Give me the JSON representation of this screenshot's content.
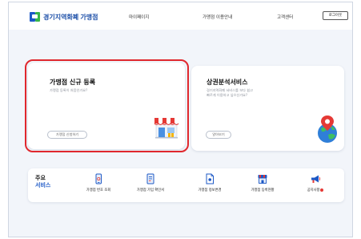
{
  "header": {
    "logo_text": "경기지역화폐 가맹점",
    "nav": [
      "마이페이지",
      "가맹점 이용안내",
      "고객센터"
    ],
    "logout_label": "로그아웃"
  },
  "cards": {
    "registration": {
      "title": "가맹점 신규 등록",
      "desc": "가맹점 등록이 처음인가요?",
      "button": "가맹점 신청하기",
      "icon": "store-icon"
    },
    "analysis": {
      "title": "상권분석서비스",
      "desc_line1": "경기지역화폐 서비스를 보다 쉽고",
      "desc_line2": "빠르게 이용하고 싶으신가요?",
      "button": "알아보기",
      "icon": "globe-location-icon"
    }
  },
  "services": {
    "heading_line1": "주요",
    "heading_line2": "서비스",
    "items": [
      {
        "label": "가맹점 번호 조회",
        "icon": "phone-icon"
      },
      {
        "label": "가맹점 가입 확인서",
        "icon": "document-icon"
      },
      {
        "label": "가맹점 정보변경",
        "icon": "file-edit-icon"
      },
      {
        "label": "가맹점 등록현황",
        "icon": "shop-status-icon"
      },
      {
        "label": "공지사항",
        "icon": "megaphone-icon"
      }
    ]
  },
  "colors": {
    "brand_blue": "#1c58c6",
    "brand_green": "#38b54a",
    "highlight_red": "#e0282e",
    "background": "#f2f5fa"
  }
}
